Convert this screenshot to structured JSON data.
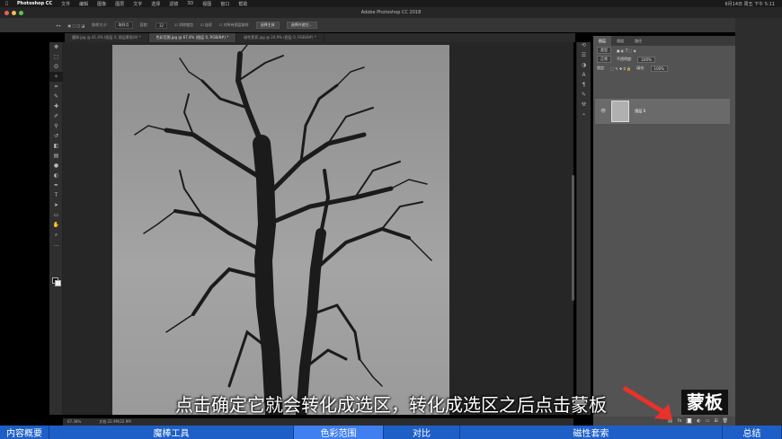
{
  "menubar": {
    "app": "Photoshop CC",
    "items": [
      "文件",
      "编辑",
      "图像",
      "图层",
      "文字",
      "选择",
      "滤镜",
      "3D",
      "视图",
      "窗口",
      "帮助"
    ],
    "clock": "6月14日 周五 下午 5:11"
  },
  "window": {
    "title": "Adobe Photoshop CC 2018"
  },
  "options_bar": {
    "sample_size_label": "取样大小:",
    "sample_size_value": "取样点",
    "tolerance_label": "容差:",
    "tolerance_value": "32",
    "anti_alias": "消除锯齿",
    "contiguous": "连续",
    "sample_all_layers": "对所有图层取样",
    "select_subject": "选择主体",
    "select_and_mask": "选择并遮住..."
  },
  "doc_tabs": [
    {
      "label": "魔棒.jpg @ 41.4% (图层 0, 图层蒙版/8) *",
      "active": false
    },
    {
      "label": "色彩范围.jpg @ 67.4% (图层 0, RGB/8#) *",
      "active": true
    },
    {
      "label": "磁性套索.jpg @ 24.9% (图层 0, RGB/8#) *",
      "active": false
    }
  ],
  "tools": [
    "move-tool",
    "marquee-tool",
    "lasso-tool",
    "magic-wand-tool",
    "crop-tool",
    "eyedropper-tool",
    "healing-tool",
    "brush-tool",
    "stamp-tool",
    "history-brush-tool",
    "eraser-tool",
    "gradient-tool",
    "blur-tool",
    "dodge-tool",
    "pen-tool",
    "type-tool",
    "path-select-tool",
    "shape-tool",
    "hand-tool",
    "zoom-tool"
  ],
  "status": {
    "zoom": "67.38%",
    "doc_info": "文档:22.9M/22.9M"
  },
  "panel": {
    "tabs": [
      "图层",
      "通道",
      "路径"
    ],
    "kind_label": "类型",
    "blend_mode": "正常",
    "opacity_label": "不透明度:",
    "opacity_value": "100%",
    "lock_label": "锁定:",
    "fill_label": "填充:",
    "fill_value": "100%",
    "layer_name": "图层 0"
  },
  "overlay": {
    "caption": "点击确定它就会转化成选区，转化成选区之后点击蒙板",
    "label": "蒙板",
    "arrow_color": "#e8322a"
  },
  "chapters": [
    {
      "label": "内容概要",
      "active": false
    },
    {
      "label": "魔棒工具",
      "active": false
    },
    {
      "label": "色彩范围",
      "active": true
    },
    {
      "label": "对比",
      "active": false
    },
    {
      "label": "磁性套索",
      "active": false
    },
    {
      "label": "总结",
      "active": false
    }
  ]
}
